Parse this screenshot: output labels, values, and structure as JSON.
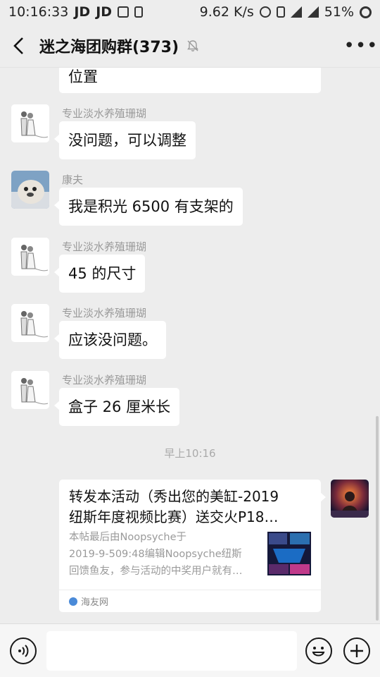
{
  "status_bar": {
    "time": "10:16:33",
    "left_icons": [
      "JD",
      "JD"
    ],
    "speed": "9.62 K/s",
    "battery": "51%"
  },
  "header": {
    "title": "迷之海团购群(373)"
  },
  "messages": [
    {
      "sender": "",
      "text": "位置"
    },
    {
      "sender": "专业淡水养殖珊瑚",
      "text": "没问题，可以调整"
    },
    {
      "sender": "康夫",
      "text": "我是积光 6500 有支架的"
    },
    {
      "sender": "专业淡水养殖珊瑚",
      "text": "45 的尺寸"
    },
    {
      "sender": "专业淡水养殖珊瑚",
      "text": "应该没问题。"
    },
    {
      "sender": "专业淡水养殖珊瑚",
      "text": "盒子 26 厘米长"
    }
  ],
  "timestamp": "早上10:16",
  "shared_card": {
    "title_line1": "转发本活动（秀出您的美缸-2019",
    "title_line2": "纽斯年度视频比赛）送交火P18…",
    "desc_line1": "本帖最后由Noopsyche于",
    "desc_line2": "2019-9-509:48编辑Noopsyche纽斯",
    "desc_line3": "回馈鱼友，参与活动的中奖用户就有…",
    "source": "海友网"
  },
  "colors": {
    "background": "#ededed",
    "bubble": "#ffffff",
    "sender_name": "#9a9a9a"
  }
}
